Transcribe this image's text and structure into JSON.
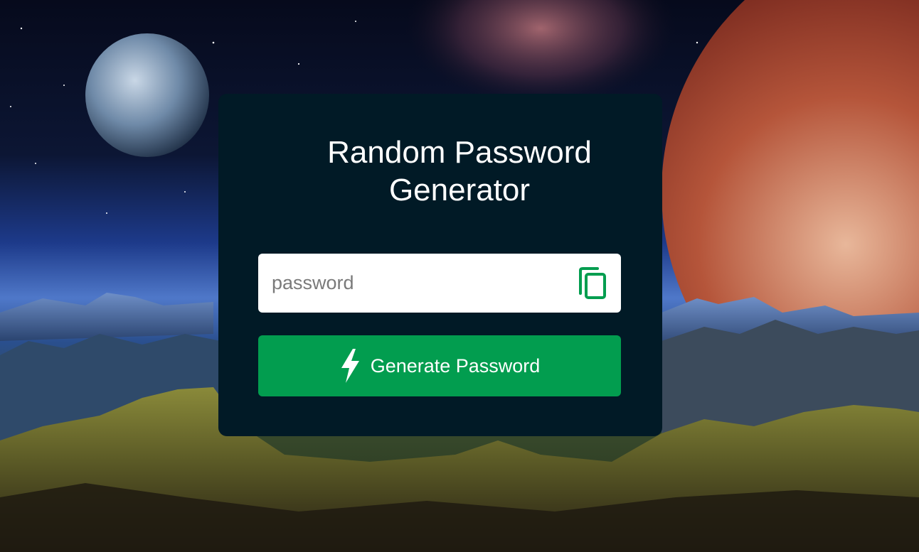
{
  "app": {
    "title": "Random Password Generator"
  },
  "password_field": {
    "value": "",
    "placeholder": "password"
  },
  "copy_button": {
    "icon": "copy-icon"
  },
  "generate_button": {
    "label": "Generate Password",
    "icon": "lightning-icon"
  },
  "colors": {
    "card": "#011a26",
    "accent": "#029d4f",
    "input_bg": "#ffffff"
  }
}
